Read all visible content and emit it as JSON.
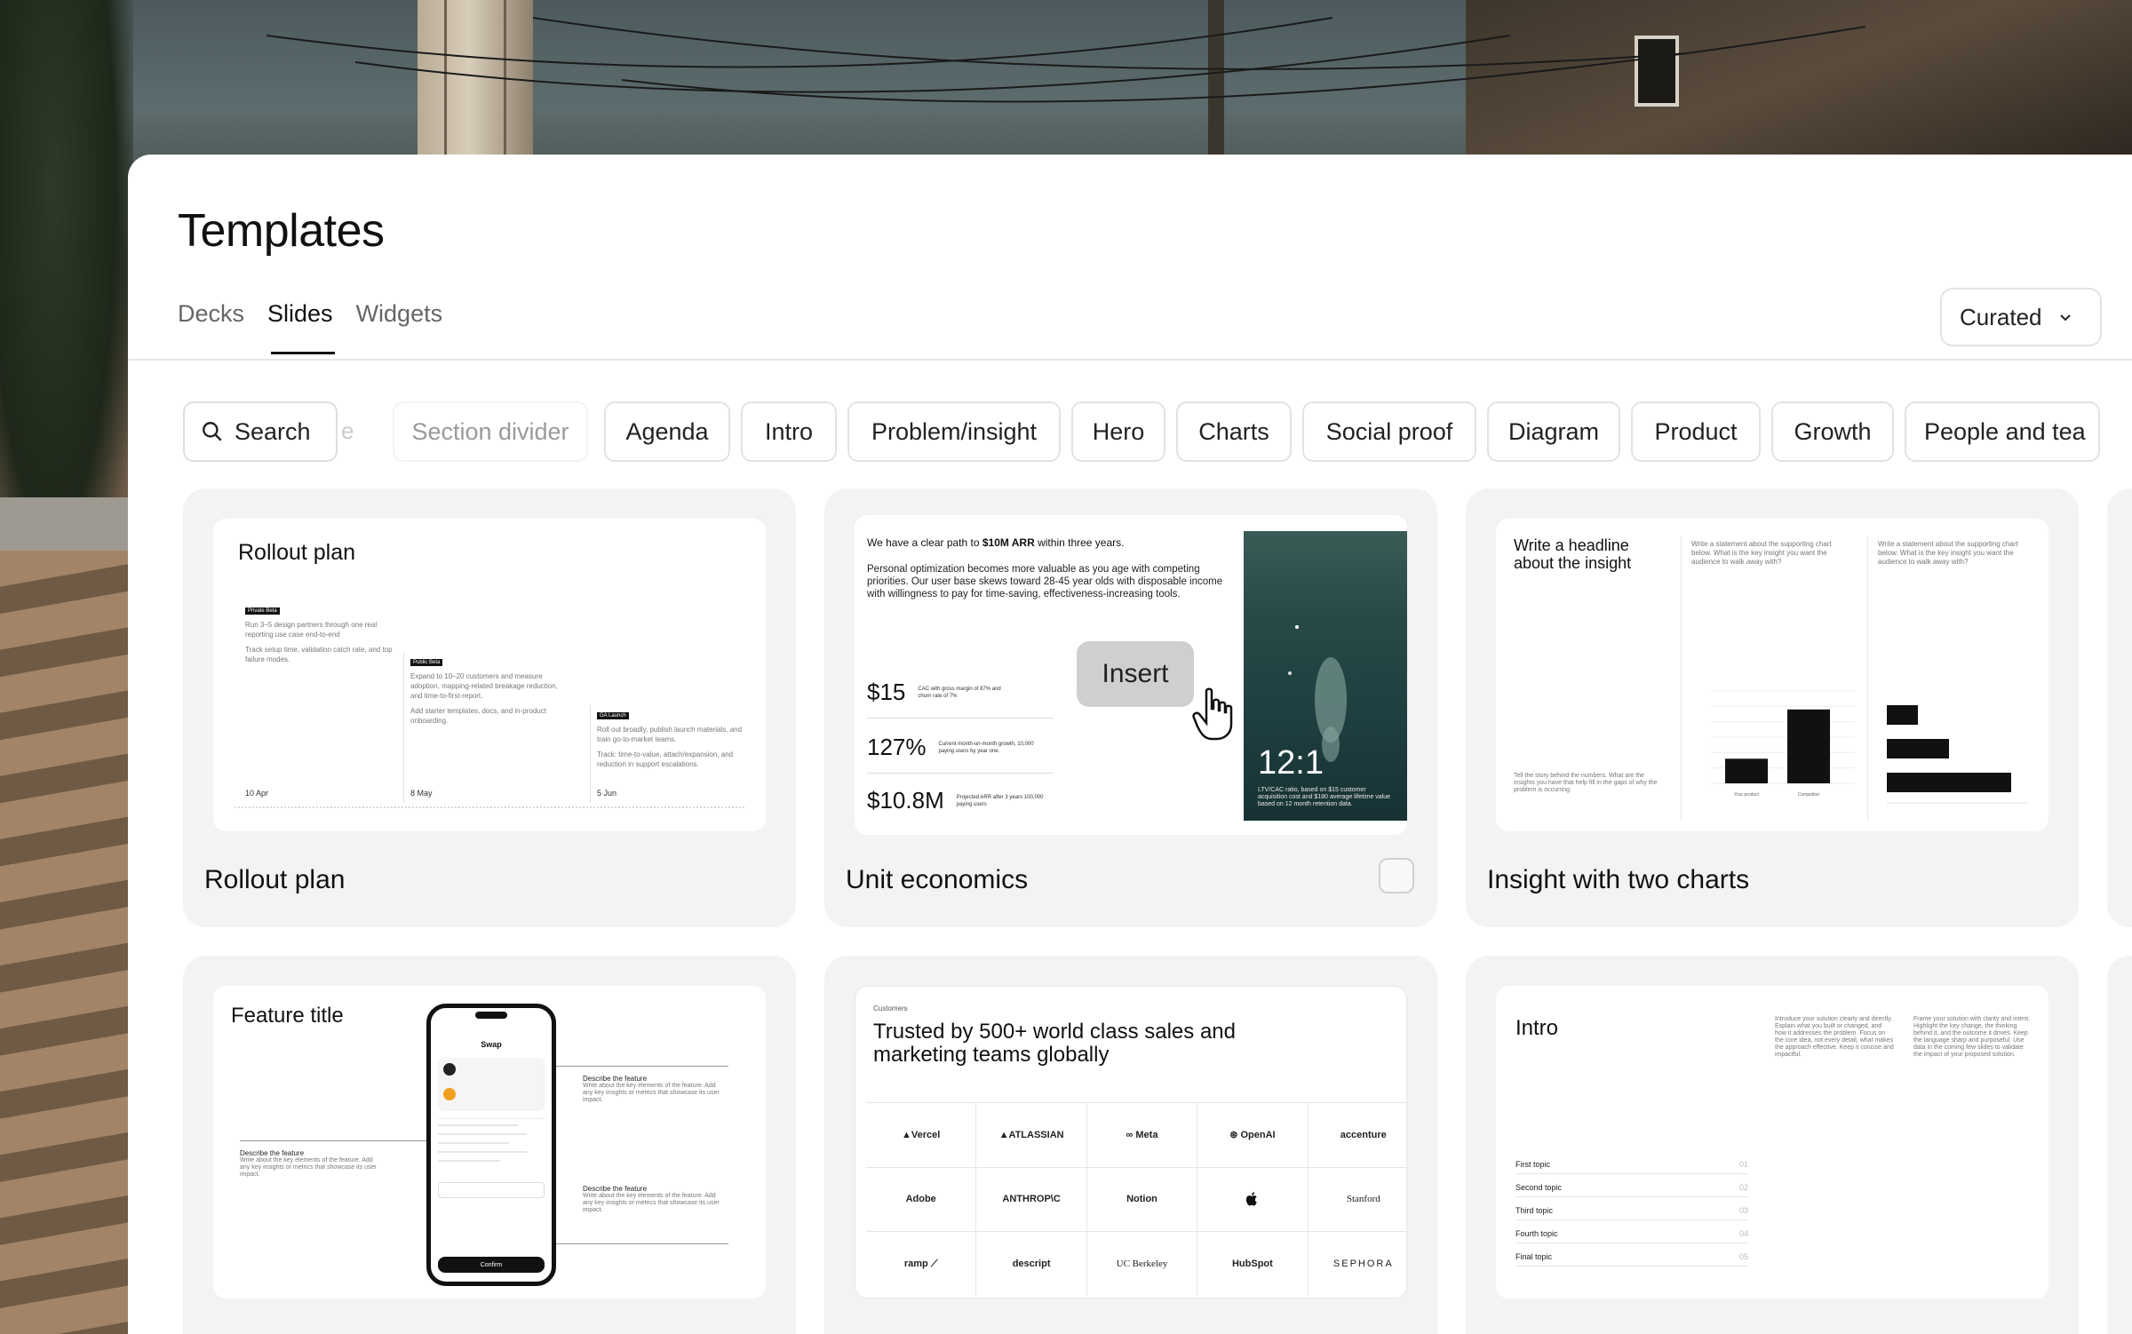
{
  "page": {
    "title": "Templates",
    "tabs": [
      {
        "label": "Decks",
        "active": false
      },
      {
        "label": "Slides",
        "active": true
      },
      {
        "label": "Widgets",
        "active": false
      }
    ],
    "sort": {
      "label": "Curated"
    }
  },
  "filters": {
    "search_label": "Search",
    "search_overflow": "e",
    "chips": [
      "Section divider",
      "Agenda",
      "Intro",
      "Problem/insight",
      "Hero",
      "Charts",
      "Social proof",
      "Diagram",
      "Product",
      "Growth",
      "People and tea"
    ]
  },
  "cards": [
    {
      "title": "Rollout plan",
      "preview": {
        "heading": "Rollout plan",
        "phases": [
          {
            "tag": "Private Beta",
            "text": "Run 3–5 design partners through one real reporting use case end-to-end",
            "text2": "Track setup time, validation catch rate, and top failure modes.",
            "date": "10 Apr"
          },
          {
            "tag": "Public Beta",
            "text": "Expand to 10–20 customers and measure adoption, mapping-related breakage reduction, and time-to-first-report.",
            "text2": "Add starter templates, docs, and in-product onboarding.",
            "date": "8 May"
          },
          {
            "tag": "GA Launch",
            "text": "Roll out broadly, publish launch materials, and train go-to-market teams.",
            "text2": "Track: time-to-value, attach/expansion, and reduction in support escalations.",
            "date": "5 Jun"
          }
        ]
      }
    },
    {
      "title": "Unit economics",
      "insert_label": "Insert",
      "preview": {
        "headline_pre": "We have a clear path to ",
        "headline_bold": "$10M ARR",
        "headline_post": " within three years.",
        "body": "Personal optimization becomes more valuable as you age with competing priorities. Our user base skews toward 28-45 year olds with disposable income with willingness to pay for time-saving, effectiveness-increasing tools.",
        "metrics": [
          {
            "value": "$15",
            "note": "CAC with gross margin of 87% and churn rate of 7%"
          },
          {
            "value": "127%",
            "note": "Current month-on-month growth, 10,000 paying users by year one."
          },
          {
            "value": "$10.8M",
            "note": "Projected ARR after 3 years 100,000 paying users"
          }
        ],
        "ratio": "12:1",
        "ratio_note": "LTV/CAC ratio, based on $15 customer acquisition cost and $180 average lifetime value based on 12 month retention data."
      }
    },
    {
      "title": "Insight with two charts",
      "preview": {
        "headline": "Write a headline about the insight",
        "story": "Tell the story behind the numbers. What are the insights you have that help fill in the gaps of why the problem is occurring.",
        "chart_prompt": "Write a statement about the supporting chart below. What is the key insight you want the audience to walk away with?",
        "bar_chart": {
          "categories": [
            "Your product",
            "Competitor"
          ],
          "values": [
            40,
            120
          ],
          "ymax": 150
        },
        "hbar_chart": {
          "values": [
            2,
            4,
            8
          ],
          "xmax": 8
        }
      }
    },
    {
      "title": "Feature title",
      "preview": {
        "heading": "Feature title",
        "app_title": "Swap",
        "confirm": "Confirm",
        "callouts": [
          {
            "title": "Describe the feature",
            "text": "Write about the key elements of the feature. Add any key insights or metrics that showcase its user impact."
          },
          {
            "title": "Describe the feature",
            "text": "Write about the key elements of the feature. Add any key insights or metrics that showcase its user impact."
          },
          {
            "title": "Describe the feature",
            "text": "Write about the key elements of the feature. Add any key insights or metrics that showcase its user impact."
          }
        ]
      }
    },
    {
      "title": "Customers",
      "preview": {
        "eyebrow": "Customers",
        "headline": "Trusted by 500+ world class sales and marketing teams globally",
        "logos": [
          "▲Vercel",
          "▲ATLASSIAN",
          "∞ Meta",
          "⊛ OpenAI",
          "accenture",
          "Adobe",
          "ANTHROP\\C",
          "Notion",
          "",
          "Stanford",
          "ramp ⟋",
          "descript",
          "UC Berkeley",
          "HubSpot",
          "SEPHORA"
        ]
      }
    },
    {
      "title": "Intro",
      "preview": {
        "heading": "Intro",
        "text_a": "Introduce your solution clearly and directly. Explain what you built or changed, and how it addresses the problem. Focus on the core idea, not every detail, what makes the approach effective. Keep it concise and impactful.",
        "text_b": "Frame your solution with clarity and intent. Highlight the key change, the thinking behind it, and the outcome it drives. Keep the language sharp and purposeful. Use data in the coming few slides to validate the impact of your proposed solution.",
        "topics": [
          {
            "label": "First topic",
            "num": "01"
          },
          {
            "label": "Second topic",
            "num": "02"
          },
          {
            "label": "Third topic",
            "num": "03"
          },
          {
            "label": "Fourth topic",
            "num": "04"
          },
          {
            "label": "Final topic",
            "num": "05"
          }
        ]
      }
    }
  ]
}
